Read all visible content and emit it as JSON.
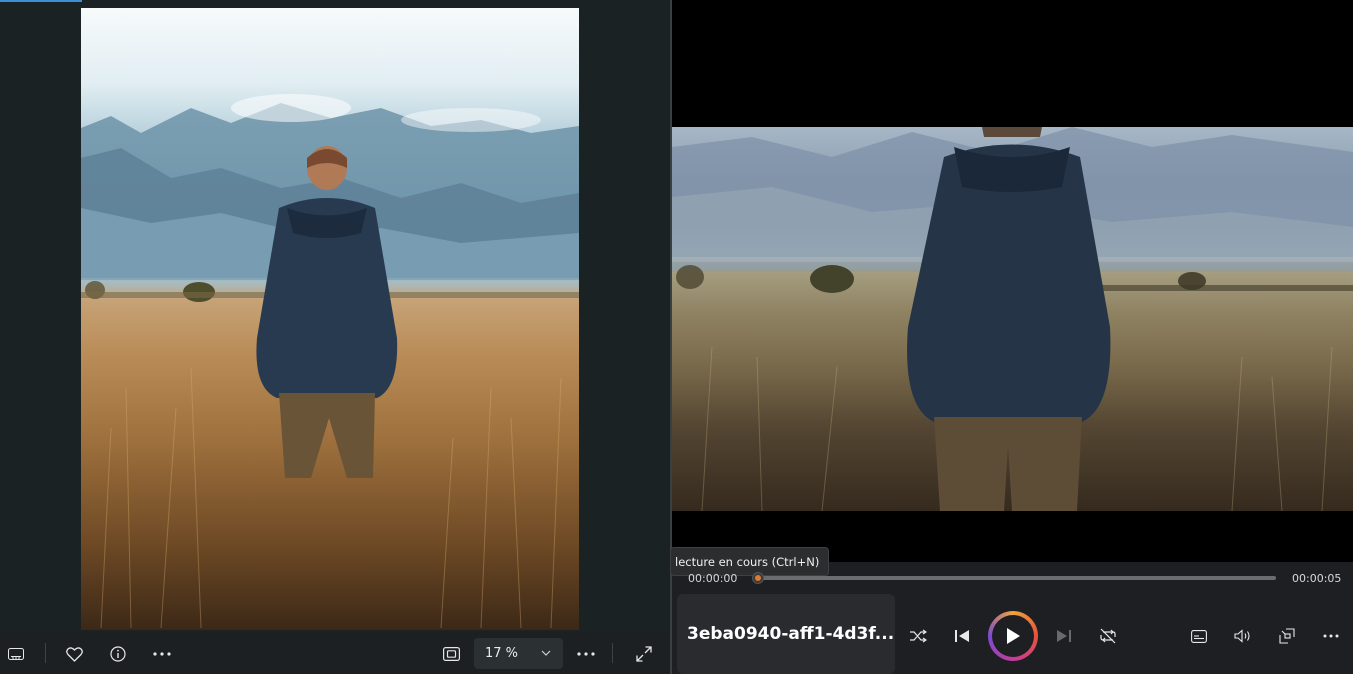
{
  "photos": {
    "zoom_value": "17 %",
    "toolbar": {
      "filmstrip_icon": "filmstrip-icon",
      "favorite_icon": "heart-icon",
      "info_icon": "info-icon",
      "more_icon": "more-icon",
      "fit_icon": "fit-to-window-icon",
      "zoom_dropdown_icon": "chevron-down-icon",
      "more_right_icon": "more-icon",
      "fullscreen_icon": "expand-icon"
    }
  },
  "player": {
    "tooltip": "lecture en cours (Ctrl+N)",
    "time_current": "00:00:00",
    "time_total": "00:00:05",
    "progress": 0.0,
    "now_playing_title": "3eba0940-aff1-4d3f...",
    "controls": {
      "shuffle_icon": "shuffle-icon",
      "previous_icon": "previous-icon",
      "play_icon": "play-icon",
      "next_icon": "next-icon",
      "repeat_icon": "repeat-off-icon",
      "subtitles_icon": "subtitles-icon",
      "volume_icon": "volume-icon",
      "miniplayer_icon": "miniplayer-icon",
      "more_icon": "more-icon"
    },
    "accent_gradient": [
      "#f0a23c",
      "#e5533a",
      "#c33c9b",
      "#7b4bd0"
    ]
  }
}
